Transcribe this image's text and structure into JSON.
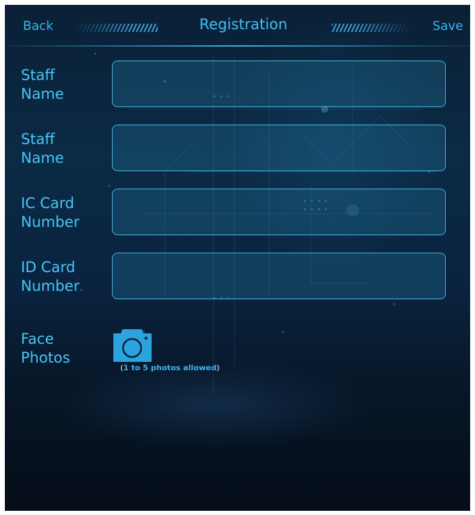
{
  "header": {
    "back_label": "Back",
    "title": "Registration",
    "save_label": "Save"
  },
  "form": {
    "fields": [
      {
        "label": "Staff\nName",
        "value": "",
        "placeholder": ""
      },
      {
        "label": "Staff\nName",
        "value": "",
        "placeholder": ""
      },
      {
        "label": "IC Card\nNumber",
        "value": "",
        "placeholder": ""
      },
      {
        "label": "ID Card\nNumber",
        "value": "",
        "placeholder": ""
      }
    ],
    "face_photos": {
      "label": "Face\nPhotos",
      "hint_open": "(",
      "hint": "1 to 5 photos allowed",
      "hint_close": ")"
    }
  },
  "icons": {
    "camera": "camera-icon"
  },
  "colors": {
    "accent": "#3fc0f5",
    "camera_fill": "#2aa3df",
    "input_border": "#50c3eb"
  }
}
